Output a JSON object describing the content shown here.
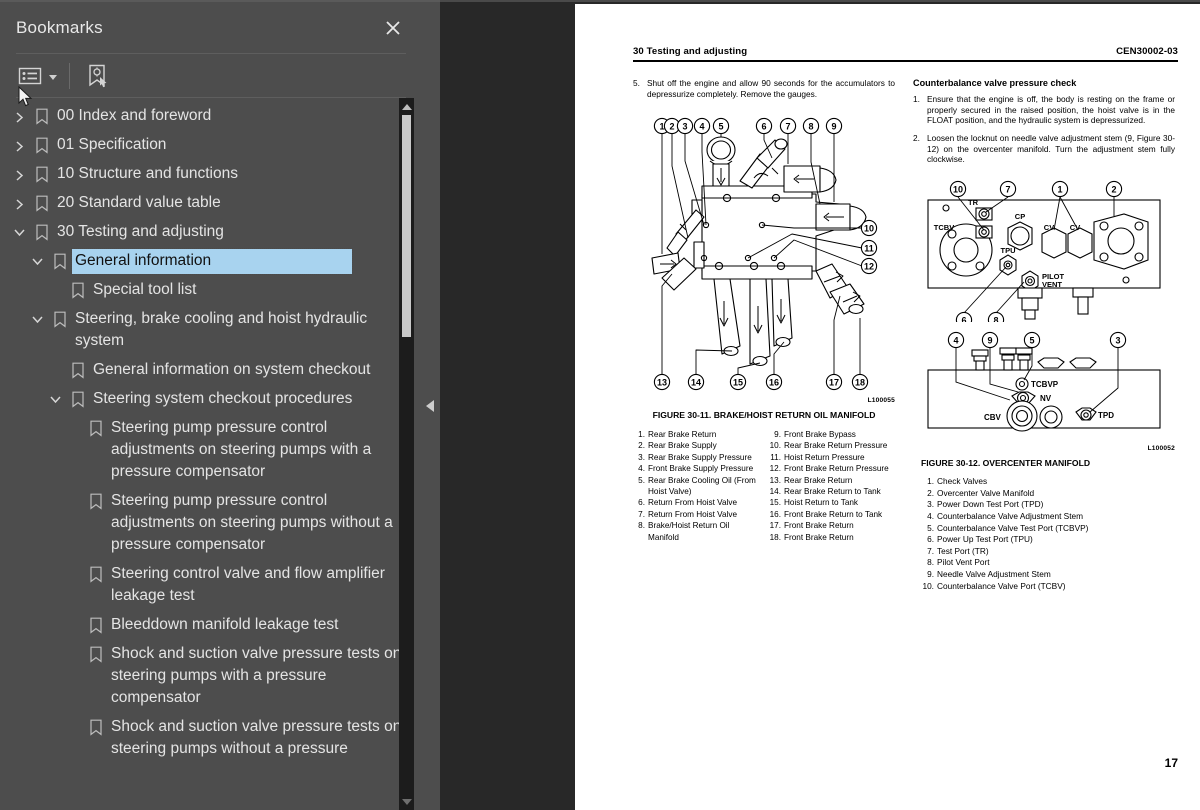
{
  "panel": {
    "title": "Bookmarks",
    "close_icon": "close-icon",
    "toolbar": {
      "options_icon": "list-options-icon",
      "options_caret": "chevron-down-icon",
      "new_bookmark_icon": "new-bookmark-icon"
    }
  },
  "colors": {
    "panel_bg": "#4d4d4d",
    "viewer_bg": "#282828",
    "selection": "#a8d3ef",
    "text": "#e4e4e4",
    "scrollbar_track": "#1c1c1c",
    "scrollbar_thumb": "#c9c9c9"
  },
  "tree": [
    {
      "label": "00 Index and foreword",
      "indent": 0,
      "twisty": "collapsed",
      "selected": false
    },
    {
      "label": "01 Specification",
      "indent": 0,
      "twisty": "collapsed",
      "selected": false
    },
    {
      "label": "10 Structure and functions",
      "indent": 0,
      "twisty": "collapsed",
      "selected": false
    },
    {
      "label": "20 Standard value table",
      "indent": 0,
      "twisty": "collapsed",
      "selected": false
    },
    {
      "label": "30 Testing and adjusting",
      "indent": 0,
      "twisty": "expanded",
      "selected": false
    },
    {
      "label": "General information",
      "indent": 1,
      "twisty": "expanded",
      "selected": true
    },
    {
      "label": "Special tool list",
      "indent": 2,
      "twisty": "none",
      "selected": false
    },
    {
      "label": "Steering, brake cooling and hoist hydraulic system",
      "indent": 1,
      "twisty": "expanded",
      "selected": false
    },
    {
      "label": "General information on system checkout",
      "indent": 2,
      "twisty": "none",
      "selected": false
    },
    {
      "label": "Steering system checkout procedures",
      "indent": 2,
      "twisty": "expanded",
      "selected": false
    },
    {
      "label": "Steering pump pressure control adjustments on steering pumps with a pressure compensator",
      "indent": 3,
      "twisty": "none",
      "selected": false
    },
    {
      "label": "Steering pump pressure control adjustments on steering pumps without a pressure compensator",
      "indent": 3,
      "twisty": "none",
      "selected": false
    },
    {
      "label": "Steering control valve and flow amplifier leakage test",
      "indent": 3,
      "twisty": "none",
      "selected": false
    },
    {
      "label": "Bleeddown manifold leakage test",
      "indent": 3,
      "twisty": "none",
      "selected": false
    },
    {
      "label": "Shock and suction valve pressure tests on steering pumps with a pressure compensator",
      "indent": 3,
      "twisty": "none",
      "selected": false
    },
    {
      "label": "Shock and suction valve pressure tests on steering pumps without a pressure",
      "indent": 3,
      "twisty": "none",
      "selected": false
    }
  ],
  "document": {
    "header_left": "30 Testing and adjusting",
    "header_right": "CEN30002-03",
    "page_number": "17",
    "left_column": {
      "steps": [
        {
          "num": "5.",
          "text": "Shut off the engine and allow 90 seconds for the accumulators to depressurize completely. Remove the gauges."
        }
      ],
      "figure_caption": "FIGURE 30-11. BRAKE/HOIST RETURN OIL MANIFOLD",
      "figure_id": "L100055",
      "callouts": [
        "1",
        "2",
        "3",
        "4",
        "5",
        "6",
        "7",
        "8",
        "9",
        "10",
        "11",
        "12",
        "13",
        "14",
        "15",
        "16",
        "17",
        "18"
      ],
      "legend_a": [
        {
          "n": "1.",
          "t": "Rear Brake Return"
        },
        {
          "n": "2.",
          "t": "Rear Brake Supply"
        },
        {
          "n": "3.",
          "t": "Rear Brake Supply Pressure"
        },
        {
          "n": "4.",
          "t": "Front Brake Supply Pressure"
        },
        {
          "n": "5.",
          "t": "Rear Brake Cooling Oil (From Hoist Valve)"
        },
        {
          "n": "6.",
          "t": "Return From Hoist Valve"
        },
        {
          "n": "7.",
          "t": "Return From Hoist Valve"
        },
        {
          "n": "8.",
          "t": "Brake/Hoist Return Oil Manifold"
        }
      ],
      "legend_b": [
        {
          "n": "9.",
          "t": "Front Brake Bypass"
        },
        {
          "n": "10.",
          "t": "Rear Brake Return Pressure"
        },
        {
          "n": "11.",
          "t": "Hoist Return Pressure"
        },
        {
          "n": "12.",
          "t": "Front Brake Return Pressure"
        },
        {
          "n": "13.",
          "t": "Rear Brake Return"
        },
        {
          "n": "14.",
          "t": "Rear Brake Return to Tank"
        },
        {
          "n": "15.",
          "t": "Hoist Return to Tank"
        },
        {
          "n": "16.",
          "t": "Front Brake Return to Tank"
        },
        {
          "n": "17.",
          "t": "Front Brake Return"
        },
        {
          "n": "18.",
          "t": "Front Brake Return"
        }
      ]
    },
    "right_column": {
      "heading": "Counterbalance valve pressure check",
      "steps": [
        {
          "num": "1.",
          "text": "Ensure that the engine is off, the body is resting on the frame or properly secured in the raised position, the hoist valve is in the FLOAT position, and the hydraulic system is depressurized."
        },
        {
          "num": "2.",
          "text": "Loosen the locknut on needle valve adjustment stem (9, Figure 30-12) on the overcenter manifold. Turn the adjustment stem fully clockwise."
        }
      ],
      "figure_caption": "FIGURE 30-12. OVERCENTER MANIFOLD",
      "figure_id": "L100052",
      "port_labels_top": [
        "TR",
        "CP",
        "CV",
        "CV",
        "TCBV",
        "TPU",
        "PILOT VENT"
      ],
      "port_labels_bottom": [
        "TCBVP",
        "NV",
        "CBV",
        "TPD"
      ],
      "callouts_top": [
        "10",
        "7",
        "1",
        "2",
        "6",
        "8"
      ],
      "callouts_bottom": [
        "4",
        "9",
        "5",
        "3"
      ],
      "legend": [
        {
          "n": "1.",
          "t": "Check Valves"
        },
        {
          "n": "2.",
          "t": "Overcenter Valve Manifold"
        },
        {
          "n": "3.",
          "t": "Power Down Test Port (TPD)"
        },
        {
          "n": "4.",
          "t": "Counterbalance Valve Adjustment Stem"
        },
        {
          "n": "5.",
          "t": "Counterbalance Valve Test Port (TCBVP)"
        },
        {
          "n": "6.",
          "t": "Power Up Test Port (TPU)"
        },
        {
          "n": "7.",
          "t": "Test Port (TR)"
        },
        {
          "n": "8.",
          "t": "Pilot Vent Port"
        },
        {
          "n": "9.",
          "t": "Needle Valve Adjustment Stem"
        },
        {
          "n": "10.",
          "t": "Counterbalance Valve Port (TCBV)"
        }
      ]
    }
  }
}
